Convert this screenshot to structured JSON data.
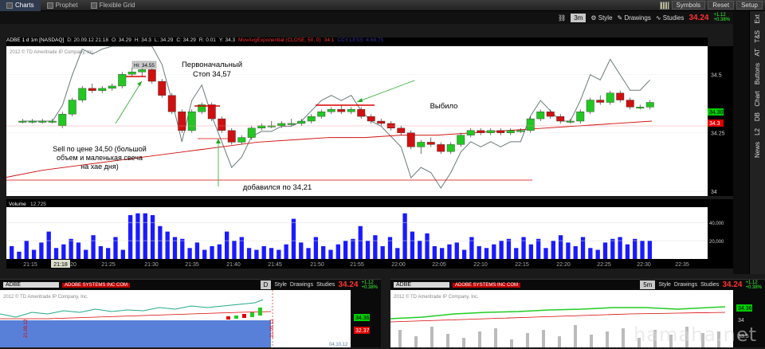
{
  "topbar": {
    "tabs": [
      {
        "label": "Charts",
        "icon": "chart-icon"
      },
      {
        "label": "Prophet",
        "icon": "prophet-icon"
      },
      {
        "label": "Flexible Grid",
        "icon": "grid-icon"
      }
    ],
    "buttons": [
      "Symbols",
      "Reset",
      "Setup"
    ]
  },
  "toolbar": {
    "timeframe": "3m",
    "style": "Style",
    "drawings": "Drawings",
    "studies": "Studies",
    "price": "34.24",
    "change1": "+1.12",
    "change2": "+0.38%"
  },
  "sidetabs": [
    "Ext",
    "T&S",
    "AT",
    "Buttons",
    "Chart",
    "DB",
    "L2",
    "News"
  ],
  "studybar": {
    "items": [
      {
        "text": "ADBE 1 d 1m [NASDAQ]",
        "color": "#ffffff"
      },
      {
        "text": "D: 20.09.12 21:18",
        "color": "#dddddd"
      },
      {
        "text": "O: 34.29",
        "color": "#dddddd"
      },
      {
        "text": "H: 34.3",
        "color": "#dddddd"
      },
      {
        "text": "L: 34.29",
        "color": "#dddddd"
      },
      {
        "text": "C: 34.29",
        "color": "#dddddd"
      },
      {
        "text": "R: 0.01",
        "color": "#dddddd"
      },
      {
        "text": "Y: 34.3",
        "color": "#dddddd"
      },
      {
        "text": "MovAvgExponential (CLOSE, 50, 0)",
        "color": "#ff3030"
      },
      {
        "text": "34.1",
        "color": "#ff3030"
      },
      {
        "text": "CCY LESS",
        "color": "#3333aa"
      },
      {
        "text": "4.68.75",
        "color": "#3333aa"
      }
    ]
  },
  "chart": {
    "copyright": "2012 © TD Ameritrade IP Company, Inc.",
    "hi_label": "Hi: 34.55",
    "annotations": {
      "stop": "Первоначальный\nСтоп 34,57",
      "sell": "Sell по цене 34,50 (большой\nобъем и маленькая свеча\nна хае дня)",
      "added": "добавился по 34,21",
      "exited": "Выбило"
    },
    "y_ticks": [
      "34.5",
      "34.25",
      "34"
    ],
    "current_price_tag": "34.30",
    "ema_tag": "34.3",
    "volume_label": "Volume",
    "volume_value": "12,725",
    "volume_ticks": [
      "40,000",
      "20,000"
    ],
    "time_labels": [
      "21:15",
      "21:18",
      "20",
      "21:25",
      "21:30",
      "21:35",
      "21:40",
      "21:45",
      "21:50",
      "21:55",
      "22:00",
      "22:05",
      "22:10",
      "22:15",
      "22:20",
      "22:25",
      "22:30",
      "22:35"
    ]
  },
  "chart_data": {
    "type": "candlestick",
    "symbol": "ADBE",
    "ylim": [
      33.98,
      34.62
    ],
    "candles": [
      [
        34.3,
        34.31,
        34.29,
        34.3
      ],
      [
        34.3,
        34.31,
        34.29,
        34.3
      ],
      [
        34.3,
        34.31,
        34.29,
        34.3
      ],
      [
        34.3,
        34.31,
        34.29,
        34.3
      ],
      [
        34.28,
        34.34,
        34.27,
        34.33
      ],
      [
        34.33,
        34.4,
        34.32,
        34.39
      ],
      [
        34.39,
        34.45,
        34.38,
        34.44
      ],
      [
        34.44,
        34.46,
        34.42,
        34.43
      ],
      [
        34.43,
        34.45,
        34.42,
        34.44
      ],
      [
        34.44,
        34.46,
        34.43,
        34.45
      ],
      [
        34.45,
        34.51,
        34.44,
        34.5
      ],
      [
        34.5,
        34.53,
        34.49,
        34.51
      ],
      [
        34.51,
        34.55,
        34.49,
        34.52
      ],
      [
        34.52,
        34.53,
        34.46,
        34.47
      ],
      [
        34.47,
        34.48,
        34.4,
        34.41
      ],
      [
        34.41,
        34.42,
        34.33,
        34.34
      ],
      [
        34.34,
        34.35,
        34.25,
        34.26
      ],
      [
        34.26,
        34.35,
        34.25,
        34.34
      ],
      [
        34.34,
        34.38,
        34.33,
        34.37
      ],
      [
        34.37,
        34.38,
        34.3,
        34.31
      ],
      [
        34.31,
        34.32,
        34.25,
        34.26
      ],
      [
        34.26,
        34.27,
        34.2,
        34.21
      ],
      [
        34.21,
        34.24,
        34.2,
        34.23
      ],
      [
        34.23,
        34.28,
        34.22,
        34.27
      ],
      [
        34.27,
        34.29,
        34.26,
        34.28
      ],
      [
        34.28,
        34.3,
        34.27,
        34.28
      ],
      [
        34.28,
        34.3,
        34.27,
        34.29
      ],
      [
        34.29,
        34.31,
        34.28,
        34.29
      ],
      [
        34.29,
        34.31,
        34.28,
        34.3
      ],
      [
        34.3,
        34.33,
        34.29,
        34.32
      ],
      [
        34.32,
        34.35,
        34.31,
        34.34
      ],
      [
        34.34,
        34.36,
        34.33,
        34.35
      ],
      [
        34.35,
        34.37,
        34.33,
        34.34
      ],
      [
        34.34,
        34.36,
        34.33,
        34.35
      ],
      [
        34.35,
        34.36,
        34.31,
        34.32
      ],
      [
        34.32,
        34.33,
        34.29,
        34.3
      ],
      [
        34.3,
        34.31,
        34.28,
        34.29
      ],
      [
        34.29,
        34.3,
        34.26,
        34.27
      ],
      [
        34.27,
        34.28,
        34.24,
        34.25
      ],
      [
        34.25,
        34.26,
        34.18,
        34.19
      ],
      [
        34.19,
        34.22,
        34.16,
        34.21
      ],
      [
        34.21,
        34.23,
        34.19,
        34.2
      ],
      [
        34.2,
        34.21,
        34.16,
        34.17
      ],
      [
        34.17,
        34.21,
        34.16,
        34.2
      ],
      [
        34.2,
        34.25,
        34.19,
        34.24
      ],
      [
        34.24,
        34.27,
        34.23,
        34.26
      ],
      [
        34.26,
        34.27,
        34.24,
        34.25
      ],
      [
        34.25,
        34.27,
        34.24,
        34.26
      ],
      [
        34.26,
        34.27,
        34.24,
        34.25
      ],
      [
        34.25,
        34.27,
        34.24,
        34.26
      ],
      [
        34.26,
        34.27,
        34.25,
        34.26
      ],
      [
        34.26,
        34.32,
        34.25,
        34.31
      ],
      [
        34.31,
        34.35,
        34.3,
        34.34
      ],
      [
        34.34,
        34.35,
        34.31,
        34.32
      ],
      [
        34.32,
        34.33,
        34.29,
        34.3
      ],
      [
        34.3,
        34.31,
        34.29,
        34.3
      ],
      [
        34.3,
        34.35,
        34.29,
        34.34
      ],
      [
        34.34,
        34.4,
        34.33,
        34.39
      ],
      [
        34.39,
        34.41,
        34.37,
        34.38
      ],
      [
        34.38,
        34.43,
        34.37,
        34.42
      ],
      [
        34.42,
        34.43,
        34.38,
        34.39
      ],
      [
        34.39,
        34.4,
        34.35,
        34.36
      ],
      [
        34.36,
        34.37,
        34.35,
        34.36
      ],
      [
        34.36,
        34.39,
        34.35,
        34.38
      ]
    ],
    "ema": [
      34.06,
      34.09,
      34.11,
      34.13,
      34.15,
      34.17,
      34.19,
      34.21,
      34.22,
      34.23,
      34.23,
      34.24,
      34.24,
      34.25,
      34.26,
      34.27,
      34.28,
      34.29,
      34.3
    ],
    "volume": [
      14,
      8,
      20,
      10,
      18,
      30,
      12,
      16,
      22,
      18,
      10,
      26,
      14,
      12,
      24,
      10,
      48,
      50,
      50,
      48,
      36,
      30,
      24,
      22,
      12,
      18,
      10,
      14,
      16,
      30,
      20,
      24,
      12,
      10,
      14,
      12,
      10,
      16,
      44,
      18,
      12,
      24,
      14,
      10,
      16,
      20,
      22,
      36,
      20,
      26,
      14,
      24,
      12,
      50,
      30,
      20,
      28,
      14,
      12,
      16,
      18,
      10,
      24,
      14,
      12,
      16,
      20,
      22,
      12,
      24,
      16,
      22,
      12,
      20,
      26,
      18,
      14,
      24,
      12,
      10,
      18,
      22,
      24,
      16,
      22,
      20,
      20
    ],
    "volume_ylim": [
      0,
      55000
    ]
  },
  "pane_left": {
    "symbol": "ADBE",
    "company": "ADOBE SYSTEMS INC COM",
    "timeframe": "D",
    "style": "Style",
    "drawings": "Drawings",
    "studies": "Studies",
    "price": "34.24",
    "change1": "+1.12",
    "change2": "+0.38%",
    "copyright": "2012 © TD Ameritrade IP Company, Inc.",
    "tag1": "34.36",
    "tag2": "32.37",
    "date1": "21.09.12",
    "date2": "21.09.12",
    "bottom_date": "04.10.12"
  },
  "pane_right": {
    "symbol": "ADBE",
    "company": "ADOBE SYSTEMS INC COM",
    "timeframe": "5m",
    "style": "Style",
    "drawings": "Drawings",
    "studies": "Studies",
    "price": "34.24",
    "change1": "+1.12",
    "change2": "+0.38%",
    "copyright": "2012 © TD Ameritrade IP Company, Inc.",
    "tag1": "34.36",
    "ytick1": "34",
    "ytick2": "33.5"
  },
  "watermark": "hamaha.net",
  "colors": {
    "up": "#22c722",
    "down": "#d01010",
    "volume": "#1a1aff",
    "ema": "#d01010",
    "line": "#6a7a7a"
  }
}
